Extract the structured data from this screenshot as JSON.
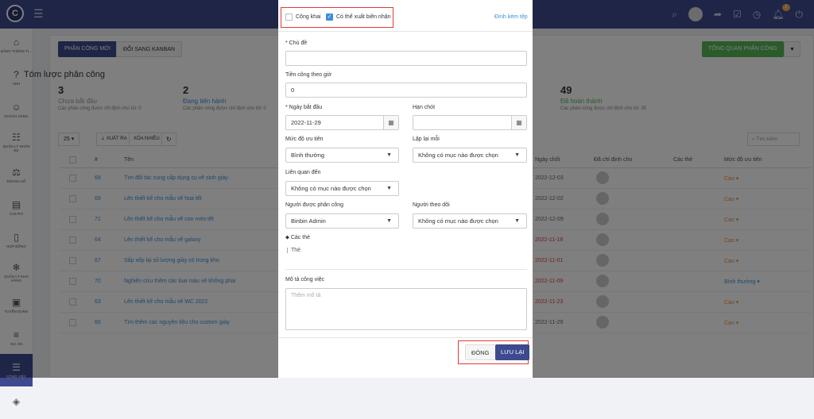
{
  "topbar": {
    "logo": "C",
    "badge": "1"
  },
  "sidebar": [
    {
      "icon": "⌂",
      "label": "BẢNG THÔNG TI...",
      "name": "dashboard"
    },
    {
      "icon": "?",
      "label": "HHH",
      "name": "help"
    },
    {
      "icon": "☺",
      "label": "KHÁCH HÀNG",
      "name": "customers"
    },
    {
      "icon": "☷",
      "label": "QUẢN LÝ NHÂN SỰ",
      "name": "hr"
    },
    {
      "icon": "⚖",
      "label": "DOANH SỐ",
      "name": "sales"
    },
    {
      "icon": "▤",
      "label": "CHI PHÍ",
      "name": "expenses"
    },
    {
      "icon": "▯",
      "label": "HỢP ĐỒNG",
      "name": "contracts"
    },
    {
      "icon": "❄",
      "label": "QUẢN LÝ KHO HÀNG",
      "name": "warehouse"
    },
    {
      "icon": "▣",
      "label": "TUYỂN DỤNG",
      "name": "recruitment"
    },
    {
      "icon": "≡",
      "label": "DỰ ÁN",
      "name": "projects"
    },
    {
      "icon": "☰",
      "label": "CÔNG VIỆC",
      "name": "tasks"
    },
    {
      "icon": "◈",
      "label": "",
      "name": "more"
    }
  ],
  "toolbar": {
    "new_task": "PHÂN CÔNG MỚI",
    "switch_kanban": "ĐỔI SANG KANBAN",
    "overview": "TỔNG QUAN PHÂN CÔNG"
  },
  "summary": {
    "title": "Tóm lược phân công",
    "stats": [
      {
        "count": "3",
        "label": "Chưa bắt đầu",
        "desc": "Các phân công được chỉ định cho tôi: 0",
        "color": "#999999"
      },
      {
        "count": "2",
        "label": "Đang tiến hành",
        "desc": "Các phân công được chỉ định cho tôi: 0",
        "color": "#3d8edb"
      },
      {
        "count": "49",
        "label": "Đã hoàn thành",
        "desc": "Các phân công được chỉ định cho tôi: 35",
        "color": "#57b557"
      }
    ]
  },
  "tabletools": {
    "page_size": "25",
    "export": "XUẤT RA",
    "bulk_delete": "XÓA NHIỀU",
    "search_placeholder": "Tìm kiếm"
  },
  "table": {
    "headers": {
      "id": "#",
      "name": "Tên",
      "due": "Ngày chốt",
      "assignee": "Đã chỉ định cho",
      "tags": "Các thẻ",
      "priority": "Mức độ ưu tiên"
    },
    "rows": [
      {
        "id": "68",
        "name": "Tìm đối tác cung cấp dụng cụ vẽ sinh giày",
        "due": "2022-12-03",
        "overdue": false,
        "priority": "Cao"
      },
      {
        "id": "69",
        "name": "Lên thiết kế cho mẫu vẽ hoa tết",
        "due": "2022-12-02",
        "overdue": false,
        "priority": "Cao"
      },
      {
        "id": "71",
        "name": "Lên thiết kế cho mẫu vẽ con mèo tết",
        "due": "2022-12-09",
        "overdue": false,
        "priority": "Cao"
      },
      {
        "id": "64",
        "name": "Lên thiết kế cho mẫu vẽ galaxy",
        "due": "2022-11-18",
        "overdue": true,
        "priority": "Cao"
      },
      {
        "id": "67",
        "name": "Sắp xếp lại số lượng giày có trong kho",
        "due": "2022-11-01",
        "overdue": true,
        "priority": "Cao"
      },
      {
        "id": "70",
        "name": "Nghiên cứu thêm các loại màu vẽ không phai",
        "due": "2022-11-09",
        "overdue": true,
        "priority": "Bình thường"
      },
      {
        "id": "63",
        "name": "Lên thiết kế cho mẫu vẽ WC 2022",
        "due": "2022-11-23",
        "overdue": true,
        "priority": "Cao"
      },
      {
        "id": "66",
        "name": "Tìm thêm các nguyên liệu cho custom giày",
        "due": "2022-11-29",
        "overdue": false,
        "priority": "Cao"
      }
    ]
  },
  "modal": {
    "public_label": "Công khai",
    "public_checked": false,
    "billable_label": "Có thể xuất biên nhận",
    "billable_checked": true,
    "attach_link": "Đính kèm tệp",
    "subject_label": "* Chủ đề",
    "subject_value": "",
    "hourly_label": "Tiền công theo giờ",
    "hourly_value": "0",
    "start_label": "* Ngày bắt đầu",
    "start_value": "2022-11-29",
    "due_label": "Hạn chót",
    "due_value": "",
    "priority_label": "Mức độ ưu tiên",
    "priority_value": "Bình thường",
    "repeat_label": "Lặp lại mỗi",
    "repeat_value": "Không có mục nào được chọn",
    "related_label": "Liên quan đến",
    "related_value": "Không có mục nào được chọn",
    "assignee_label": "Người được phân công",
    "assignee_value": "Binbin Admin",
    "follower_label": "Người theo dõi",
    "follower_value": "Không có mục nào được chọn",
    "tags_label": "Các thẻ",
    "tags_placeholder": "Thẻ",
    "desc_label": "Mô tả công việc",
    "desc_placeholder": "Thêm mô tả",
    "close_button": "ĐÓNG",
    "save_button": "LƯU LẠI"
  }
}
